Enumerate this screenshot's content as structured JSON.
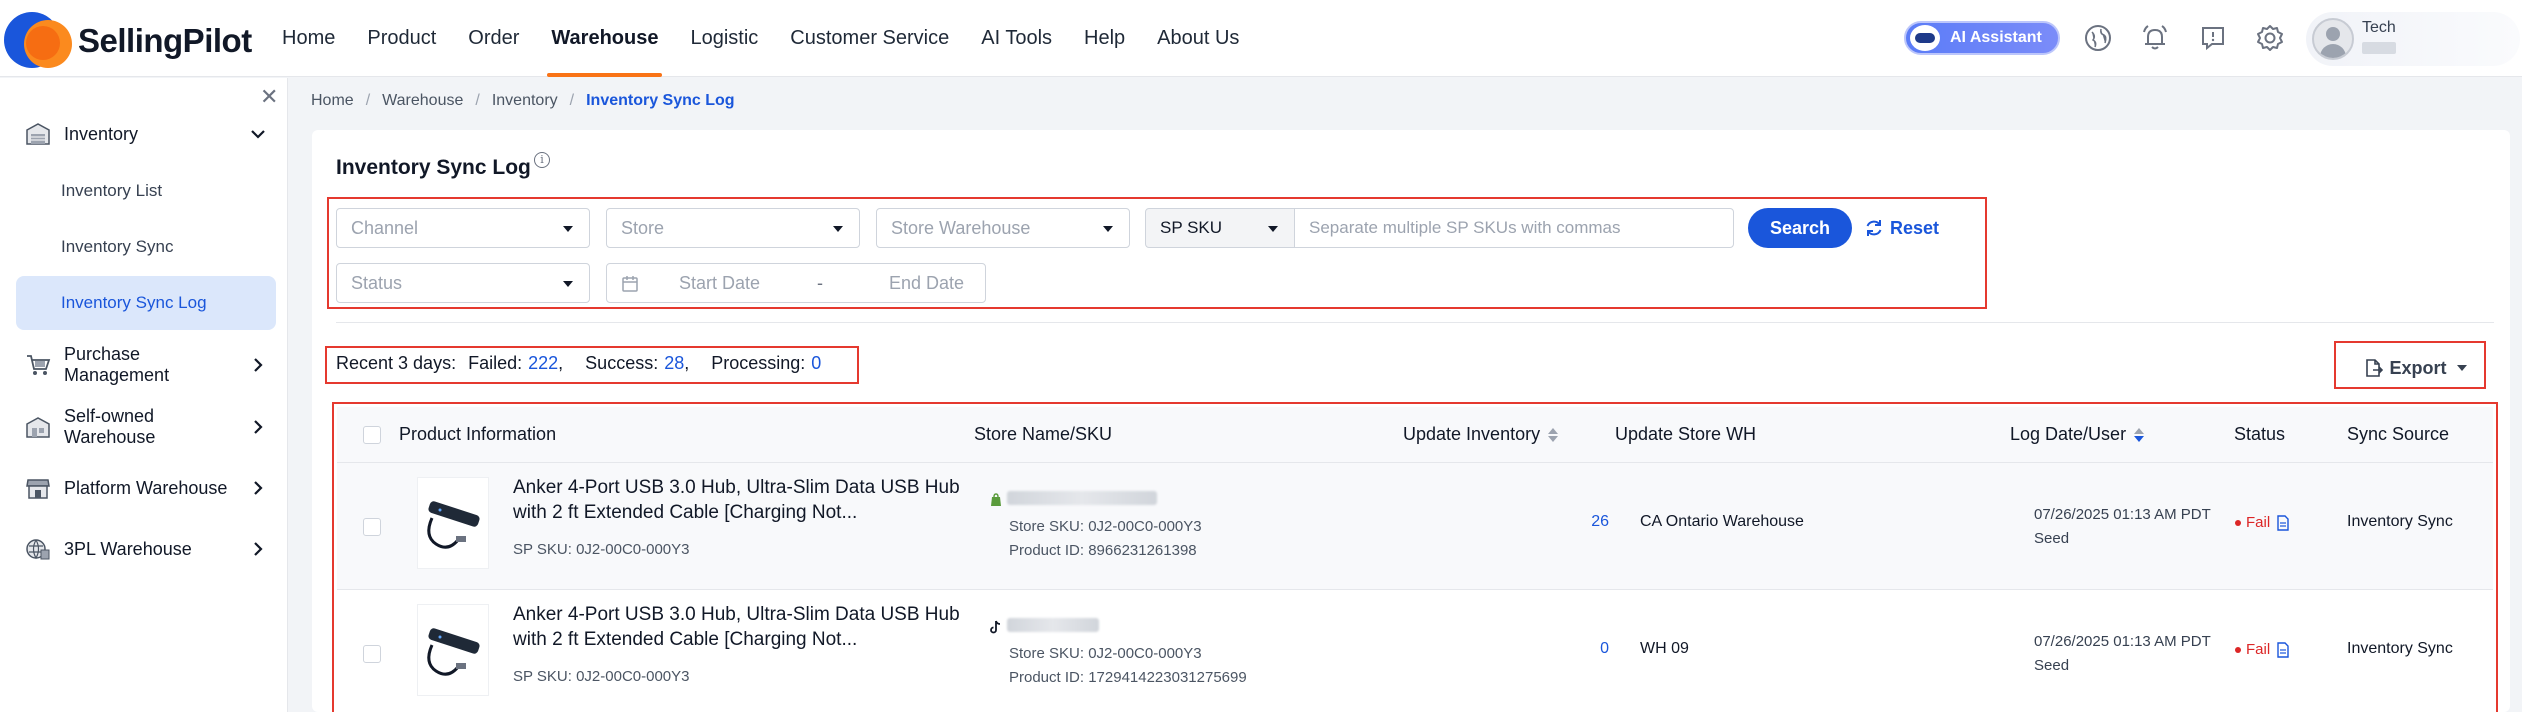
{
  "brand": {
    "name": "SellingPilot"
  },
  "nav": [
    {
      "label": "Home",
      "active": false
    },
    {
      "label": "Product",
      "active": false
    },
    {
      "label": "Order",
      "active": false
    },
    {
      "label": "Warehouse",
      "active": true
    },
    {
      "label": "Logistic",
      "active": false
    },
    {
      "label": "Customer Service",
      "active": false
    },
    {
      "label": "AI Tools",
      "active": false
    },
    {
      "label": "Help",
      "active": false
    },
    {
      "label": "About Us",
      "active": false
    }
  ],
  "header": {
    "ai_label": "AI Assistant",
    "user_name": "Tech"
  },
  "sidebar": {
    "groups": [
      {
        "label": "Inventory",
        "icon": "warehouse-icon",
        "expanded": true
      },
      {
        "label": "Purchase Management",
        "icon": "cart-icon"
      },
      {
        "label": "Self-owned Warehouse",
        "icon": "building-icon"
      },
      {
        "label": "Platform Warehouse",
        "icon": "store-icon"
      },
      {
        "label": "3PL Warehouse",
        "icon": "globe-warehouse-icon"
      }
    ],
    "inventory_items": [
      {
        "label": "Inventory List",
        "active": false
      },
      {
        "label": "Inventory Sync",
        "active": false
      },
      {
        "label": "Inventory Sync Log",
        "active": true
      }
    ]
  },
  "breadcrumb": [
    "Home",
    "Warehouse",
    "Inventory",
    "Inventory Sync Log"
  ],
  "page": {
    "title": "Inventory Sync Log"
  },
  "filters": {
    "channel": "Channel",
    "store": "Store",
    "store_warehouse": "Store Warehouse",
    "sku_type": "SP SKU",
    "sku_placeholder": "Separate multiple SP SKUs with commas",
    "status": "Status",
    "start_date": "Start Date",
    "end_date": "End Date",
    "date_sep": "-",
    "search_label": "Search",
    "reset_label": "Reset"
  },
  "summary": {
    "lead": "Recent 3 days:",
    "failed_label": "Failed:",
    "failed": "222",
    "success_label": "Success:",
    "success": "28",
    "processing_label": "Processing:",
    "processing": "0",
    "comma": ","
  },
  "export_label": "Export",
  "table": {
    "columns": {
      "product": "Product Information",
      "store": "Store Name/SKU",
      "update_inventory": "Update Inventory",
      "update_store_wh": "Update Store WH",
      "log_date": "Log Date/User",
      "status": "Status",
      "sync_source": "Sync Source"
    },
    "rows": [
      {
        "product_name": "Anker 4-Port USB 3.0 Hub, Ultra-Slim Data USB Hub with 2 ft Extended Cable [Charging Not...",
        "sp_sku": "SP SKU: 0J2-00C0-000Y3",
        "store_logo": "shopify-icon",
        "store_sku": "Store SKU: 0J2-00C0-000Y3",
        "product_id": "Product ID: 8966231261398",
        "inventory": "26",
        "store_wh": "CA Ontario Warehouse",
        "log_date": "07/26/2025 01:13 AM PDT",
        "log_user": "Seed",
        "status": "Fail",
        "sync_source": "Inventory Sync"
      },
      {
        "product_name": "Anker 4-Port USB 3.0 Hub, Ultra-Slim Data USB Hub with 2 ft Extended Cable [Charging Not...",
        "sp_sku": "SP SKU: 0J2-00C0-000Y3",
        "store_logo": "tiktok-icon",
        "store_sku": "Store SKU: 0J2-00C0-000Y3",
        "product_id": "Product ID: 1729414223031275699",
        "inventory": "0",
        "store_wh": "WH 09",
        "log_date": "07/26/2025 01:13 AM PDT",
        "log_user": "Seed",
        "status": "Fail",
        "sync_source": "Inventory Sync"
      }
    ]
  },
  "colors": {
    "primary": "#1a56db",
    "accent": "#f97316",
    "danger": "#dc2626",
    "highlight": "#e5392f"
  }
}
